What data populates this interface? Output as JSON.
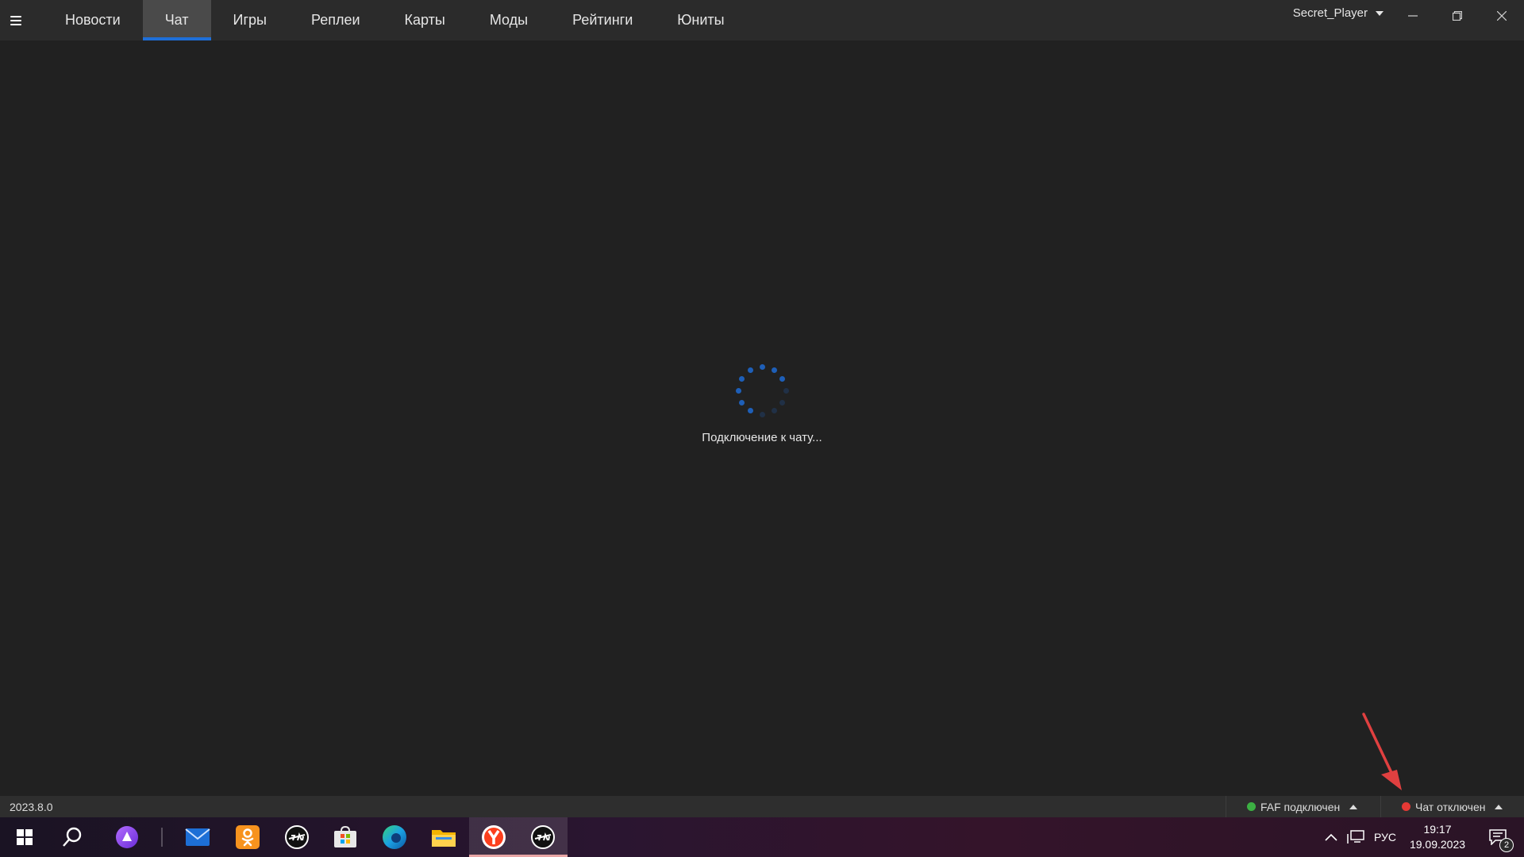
{
  "window": {
    "menu_icon": "hamburger-icon",
    "user_name": "Secret_Player",
    "controls": [
      "minimize-icon",
      "restore-icon",
      "close-icon"
    ]
  },
  "nav": {
    "tabs": [
      {
        "label": "Новости",
        "active": false
      },
      {
        "label": "Чат",
        "active": true
      },
      {
        "label": "Игры",
        "active": false
      },
      {
        "label": "Реплеи",
        "active": false
      },
      {
        "label": "Карты",
        "active": false
      },
      {
        "label": "Моды",
        "active": false
      },
      {
        "label": "Рейтинги",
        "active": false
      },
      {
        "label": "Юниты",
        "active": false
      }
    ]
  },
  "main": {
    "loading_text": "Подключение к чату..."
  },
  "statusbar": {
    "version": "2023.8.0",
    "faf_status": {
      "label": "FAF подключен",
      "color": "#3cb043"
    },
    "chat_status": {
      "label": "Чат отключен",
      "color": "#e53935"
    }
  },
  "taskbar": {
    "apps": [
      "start-icon",
      "search-icon",
      "alice-icon",
      "mail-icon",
      "odnoklassniki-icon",
      "faf-icon",
      "store-icon",
      "edge-icon",
      "file-explorer-icon",
      "yandex-browser-icon",
      "faf-client-icon"
    ],
    "tray": {
      "language": "РУС",
      "time": "19:17",
      "date": "19.09.2023",
      "notifications": "2"
    }
  },
  "colors": {
    "accent": "#1e6fd9",
    "background": "#212121",
    "topbar": "#2b2b2b"
  }
}
